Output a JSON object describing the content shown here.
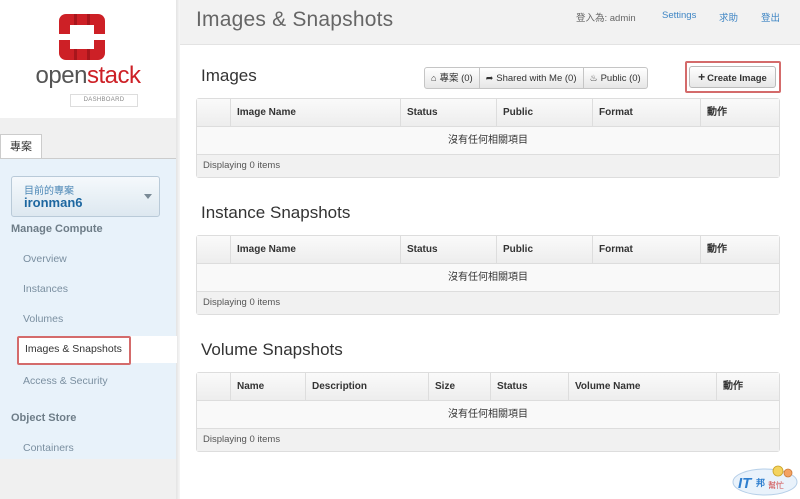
{
  "sidebar": {
    "logo": {
      "text_open": "open",
      "text_stack": "stack",
      "subtitle": "DASHBOARD"
    },
    "project_tab": "專案",
    "project_switcher": {
      "label": "目前的專案",
      "value": "ironman6"
    },
    "sections": [
      {
        "heading": "Manage Compute",
        "items": [
          "Overview",
          "Instances",
          "Volumes",
          "Images & Snapshots",
          "Access & Security"
        ]
      },
      {
        "heading": "Object Store",
        "items": [
          "Containers"
        ]
      }
    ],
    "active_item": "Images & Snapshots"
  },
  "header": {
    "title": "Images & Snapshots",
    "logged_in_as": "登入為: admin",
    "settings": "Settings",
    "help": "求助",
    "signout": "登出"
  },
  "images": {
    "title": "Images",
    "filters": [
      {
        "icon": "home-icon",
        "label": "專案 (0)"
      },
      {
        "icon": "share-icon",
        "label": "Shared with Me (0)"
      },
      {
        "icon": "fire-icon",
        "label": "Public (0)"
      }
    ],
    "create_label": "Create Image",
    "columns": [
      "Image Name",
      "Status",
      "Public",
      "Format",
      "動作"
    ],
    "empty": "沒有任何相關項目",
    "footer": "Displaying 0 items"
  },
  "instance_snapshots": {
    "title": "Instance Snapshots",
    "columns": [
      "Image Name",
      "Status",
      "Public",
      "Format",
      "動作"
    ],
    "empty": "沒有任何相關項目",
    "footer": "Displaying 0 items"
  },
  "volume_snapshots": {
    "title": "Volume Snapshots",
    "columns": [
      "Name",
      "Description",
      "Size",
      "Status",
      "Volume Name",
      "動作"
    ],
    "empty": "沒有任何相關項目",
    "footer": "Displaying 0 items"
  },
  "watermark": {
    "text": "IT邦幫忙"
  },
  "colors": {
    "accent_red": "#cd2026",
    "link_blue": "#3e85c4",
    "highlight": "#d46b6b",
    "sidebar_panel": "#e8f2fa"
  }
}
